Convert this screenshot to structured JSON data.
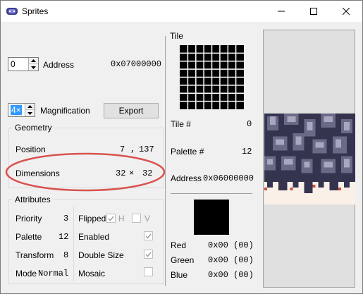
{
  "window": {
    "title": "Sprites",
    "minimize_icon": "minimize-icon",
    "maximize_icon": "maximize-icon",
    "close_icon": "close-icon"
  },
  "address": {
    "spin_value": "0",
    "label": "Address",
    "value": "0x07000000"
  },
  "magnification": {
    "spin_value": "4×",
    "label": "Magnification",
    "export_label": "Export"
  },
  "geometry": {
    "title": "Geometry",
    "position_label": "Position",
    "position_x": "7",
    "position_sep": ",",
    "position_y": "137",
    "dimensions_label": "Dimensions",
    "dimensions_w": "32",
    "dimensions_sep": "×",
    "dimensions_h": "32",
    "highlight_color": "#d9534f"
  },
  "attributes": {
    "title": "Attributes",
    "priority_label": "Priority",
    "priority_value": "3",
    "palette_label": "Palette",
    "palette_value": "12",
    "transform_label": "Transform",
    "transform_value": "8",
    "mode_label": "Mode",
    "mode_value": "Normal",
    "flipped_label": "Flipped",
    "flip_h_label": "H",
    "flip_h_checked": true,
    "flip_v_label": "V",
    "flip_v_checked": false,
    "enabled_label": "Enabled",
    "enabled_checked": true,
    "double_size_label": "Double Size",
    "double_size_checked": true,
    "mosaic_label": "Mosaic",
    "mosaic_checked": false
  },
  "tile": {
    "title": "Tile",
    "tile_num_label": "Tile #",
    "tile_num_value": "0",
    "palette_num_label": "Palette #",
    "palette_num_value": "12",
    "address_label": "Address",
    "address_value": "0x06000000"
  },
  "color": {
    "swatch_color": "#000000",
    "red_label": "Red",
    "red_value": "0x00 (00)",
    "green_label": "Green",
    "green_value": "0x00 (00)",
    "blue_label": "Blue",
    "blue_value": "0x00 (00)"
  },
  "colors": {
    "sprite_dark": "#34344f",
    "sprite_mid": "#6a6a86",
    "sprite_light": "#a7a7bf",
    "sprite_bg": "#fbf0e8",
    "sprite_red": "#c9503f"
  }
}
